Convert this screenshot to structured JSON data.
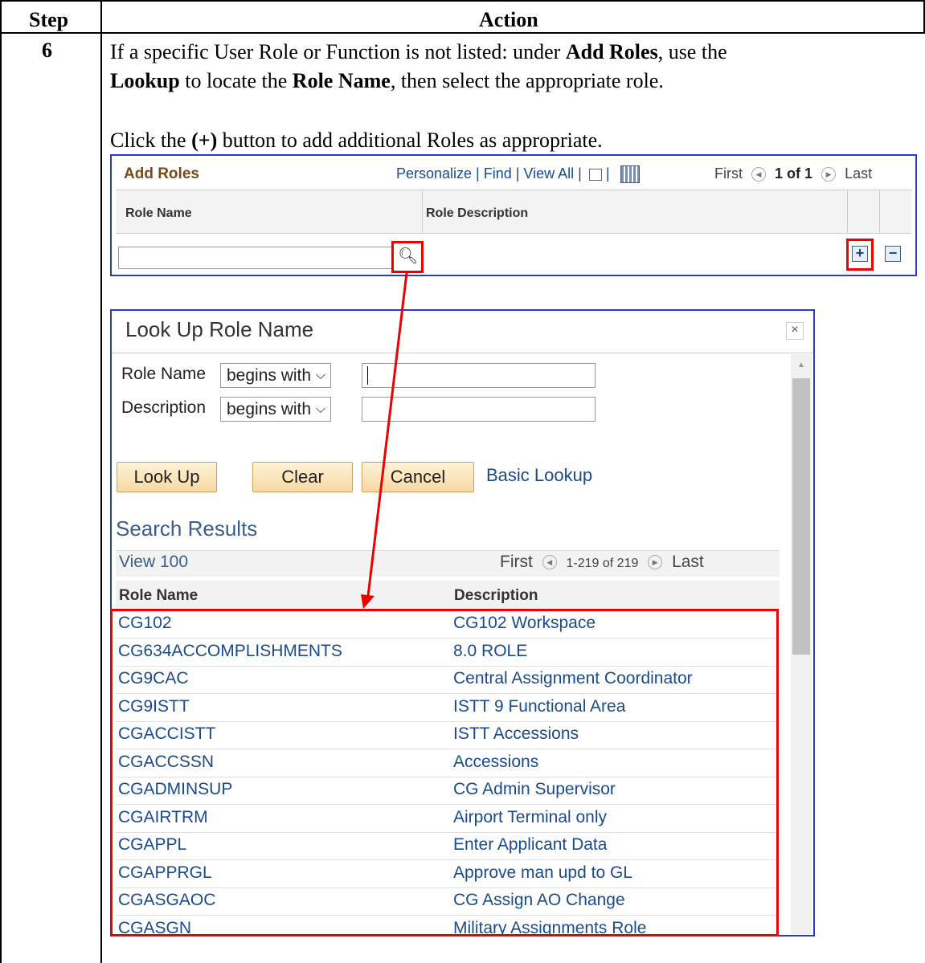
{
  "table": {
    "header_step": "Step",
    "header_action": "Action",
    "step_number": "6"
  },
  "instructions": {
    "line1_pre": "If a specific User Role or Function is not listed:  under ",
    "line1_bold": "Add Roles",
    "line1_post": ", use the",
    "line2_bold1": "Lookup",
    "line2_mid": " to locate the ",
    "line2_bold2": "Role Name",
    "line2_post": ", then select the appropriate role.",
    "line3_pre": "Click the ",
    "line3_bold": "(+)",
    "line3_post": " button to add additional Roles as appropriate."
  },
  "add_roles": {
    "title": "Add Roles",
    "nav_links": "Personalize | Find | View All |",
    "first": "First",
    "page": "1 of 1",
    "last": "Last",
    "col_role_name": "Role Name",
    "col_role_description": "Role Description",
    "plus": "+",
    "minus": "−"
  },
  "lookup": {
    "title": "Look Up Role Name",
    "close": "×",
    "label_role_name": "Role Name",
    "label_description": "Description",
    "operator_role_name": "begins with",
    "operator_description": "begins with",
    "btn_lookup": "Look Up",
    "btn_clear": "Clear",
    "btn_cancel": "Cancel",
    "basic_lookup": "Basic Lookup",
    "search_results": "Search Results",
    "view_100": "View 100",
    "first": "First",
    "range": "1-219 of 219",
    "last": "Last",
    "col_role_name": "Role Name",
    "col_description": "Description",
    "rows": [
      {
        "name": "CG102",
        "desc": "CG102 Workspace"
      },
      {
        "name": "CG634ACCOMPLISHMENTS",
        "desc": "8.0 ROLE"
      },
      {
        "name": "CG9CAC",
        "desc": "Central Assignment Coordinator"
      },
      {
        "name": "CG9ISTT",
        "desc": "ISTT 9 Functional Area"
      },
      {
        "name": "CGACCISTT",
        "desc": "ISTT Accessions"
      },
      {
        "name": "CGACCSSN",
        "desc": "Accessions"
      },
      {
        "name": "CGADMINSUP",
        "desc": "CG Admin Supervisor"
      },
      {
        "name": "CGAIRTRM",
        "desc": "Airport Terminal only"
      },
      {
        "name": "CGAPPL",
        "desc": "Enter Applicant Data"
      },
      {
        "name": "CGAPPRGL",
        "desc": "Approve man upd to GL"
      },
      {
        "name": "CGASGAOC",
        "desc": "CG Assign AO Change"
      },
      {
        "name": "CGASGN",
        "desc": "Military Assignments Role"
      }
    ]
  },
  "colors": {
    "highlight": "#e00000",
    "frame_blue": "#2a3dbf",
    "link_blue": "#1a4a8e"
  }
}
